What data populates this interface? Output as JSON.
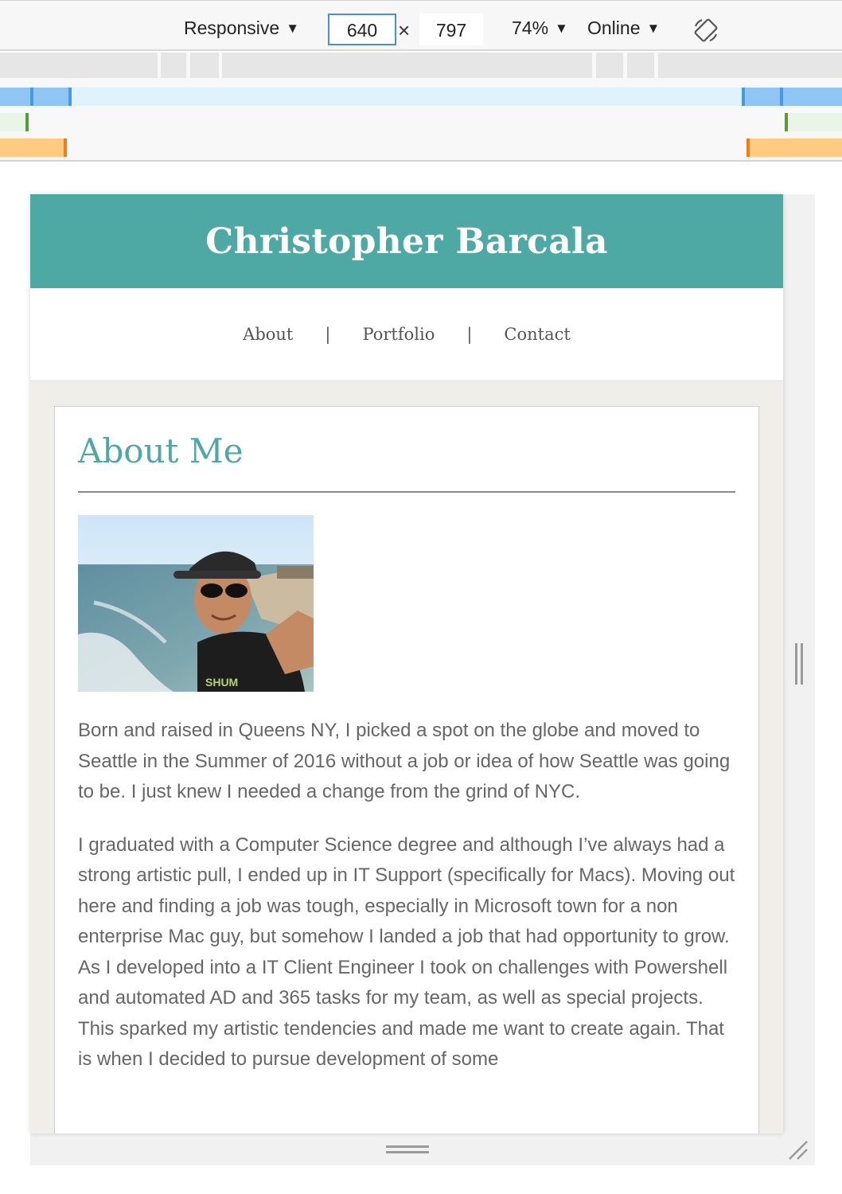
{
  "toolbar": {
    "device": "Responsive",
    "width": "640",
    "times": "×",
    "height": "797",
    "zoom": "74%",
    "throttle": "Online",
    "arrow": "▼",
    "rotate_icon": "rotate-icon"
  },
  "media_query_colors": {
    "max_width": "#8fc6f5",
    "max_width_light": "#e0f2fb",
    "min_max": "#5a9a3a",
    "min_max_light": "#e9f5e6",
    "min_width": "#ffcb82",
    "min_width_mark": "#f07c1b"
  },
  "site": {
    "title": "Christopher Barcala",
    "accent": "#4ea9a5",
    "nav": {
      "about": "About",
      "portfolio": "Portfolio",
      "contact": "Contact",
      "separator": "|"
    },
    "about": {
      "heading": "About Me",
      "photo_alt": "Selfie at the beach",
      "paragraphs": [
        "Born and raised in Queens NY, I picked a spot on the globe and moved to Seattle in the Summer of 2016 without a job or idea of how Seattle was going to be. I just knew I needed a change from the grind of NYC.",
        "I graduated with a Computer Science degree and although I’ve always had a strong artistic pull, I ended up in IT Support (specifically for Macs). Moving out here and finding a job was tough, especially in Microsoft town for a non enterprise Mac guy, but somehow I landed a job that had opportunity to grow. As I developed into a IT Client Engineer I took on challenges with Powershell and automated AD and 365 tasks for my team, as well as special projects. This sparked my artistic tendencies and made me want to create again. That is when I decided to pursue development of some"
      ]
    }
  }
}
